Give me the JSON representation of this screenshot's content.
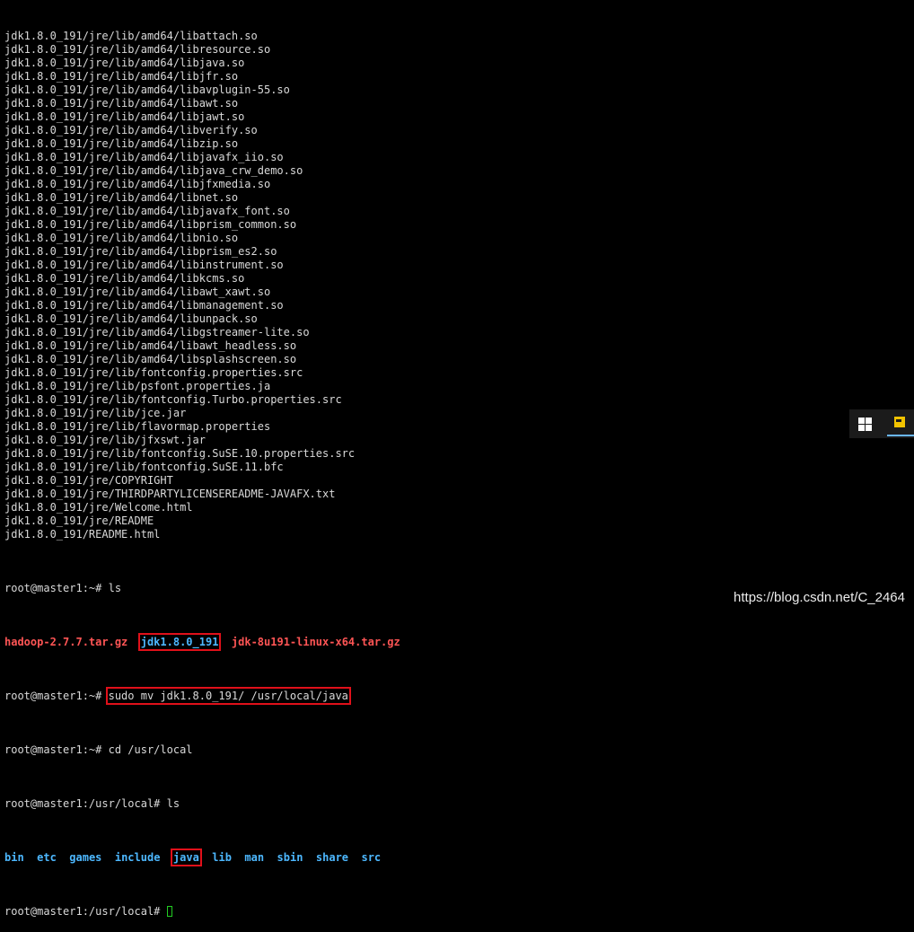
{
  "terminal": {
    "file_lines": [
      "jdk1.8.0_191/jre/lib/amd64/libattach.so",
      "jdk1.8.0_191/jre/lib/amd64/libresource.so",
      "jdk1.8.0_191/jre/lib/amd64/libjava.so",
      "jdk1.8.0_191/jre/lib/amd64/libjfr.so",
      "jdk1.8.0_191/jre/lib/amd64/libavplugin-55.so",
      "jdk1.8.0_191/jre/lib/amd64/libawt.so",
      "jdk1.8.0_191/jre/lib/amd64/libjawt.so",
      "jdk1.8.0_191/jre/lib/amd64/libverify.so",
      "jdk1.8.0_191/jre/lib/amd64/libzip.so",
      "jdk1.8.0_191/jre/lib/amd64/libjavafx_iio.so",
      "jdk1.8.0_191/jre/lib/amd64/libjava_crw_demo.so",
      "jdk1.8.0_191/jre/lib/amd64/libjfxmedia.so",
      "jdk1.8.0_191/jre/lib/amd64/libnet.so",
      "jdk1.8.0_191/jre/lib/amd64/libjavafx_font.so",
      "jdk1.8.0_191/jre/lib/amd64/libprism_common.so",
      "jdk1.8.0_191/jre/lib/amd64/libnio.so",
      "jdk1.8.0_191/jre/lib/amd64/libprism_es2.so",
      "jdk1.8.0_191/jre/lib/amd64/libinstrument.so",
      "jdk1.8.0_191/jre/lib/amd64/libkcms.so",
      "jdk1.8.0_191/jre/lib/amd64/libawt_xawt.so",
      "jdk1.8.0_191/jre/lib/amd64/libmanagement.so",
      "jdk1.8.0_191/jre/lib/amd64/libunpack.so",
      "jdk1.8.0_191/jre/lib/amd64/libgstreamer-lite.so",
      "jdk1.8.0_191/jre/lib/amd64/libawt_headless.so",
      "jdk1.8.0_191/jre/lib/amd64/libsplashscreen.so",
      "jdk1.8.0_191/jre/lib/fontconfig.properties.src",
      "jdk1.8.0_191/jre/lib/psfont.properties.ja",
      "jdk1.8.0_191/jre/lib/fontconfig.Turbo.properties.src",
      "jdk1.8.0_191/jre/lib/jce.jar",
      "jdk1.8.0_191/jre/lib/flavormap.properties",
      "jdk1.8.0_191/jre/lib/jfxswt.jar",
      "jdk1.8.0_191/jre/lib/fontconfig.SuSE.10.properties.src",
      "jdk1.8.0_191/jre/lib/fontconfig.SuSE.11.bfc",
      "jdk1.8.0_191/jre/COPYRIGHT",
      "jdk1.8.0_191/jre/THIRDPARTYLICENSEREADME-JAVAFX.txt",
      "jdk1.8.0_191/jre/Welcome.html",
      "jdk1.8.0_191/jre/README",
      "jdk1.8.0_191/README.html"
    ],
    "prompt_home": "root@master1:~# ",
    "cmd_ls1": "ls",
    "ls1": {
      "hadoop": "hadoop-2.7.7.tar.gz",
      "jdk_dir": "jdk1.8.0_191",
      "jdk_tar": "jdk-8u191-linux-x64.tar.gz"
    },
    "cmd_mv": "sudo mv jdk1.8.0_191/ /usr/local/java",
    "cmd_cd": "cd /usr/local",
    "prompt_local": "root@master1:/usr/local# ",
    "cmd_ls2": "ls",
    "ls2": {
      "bin": "bin",
      "etc": "etc",
      "games": "games",
      "include": "include",
      "java": "java",
      "lib": "lib",
      "man": "man",
      "sbin": "sbin",
      "share": "share",
      "src": "src"
    }
  },
  "colors": {
    "background": "#000000",
    "text": "#d9d9d9",
    "archive": "#ff5555",
    "directory": "#4db8ff",
    "highlight_box": "#e0101a",
    "cursor": "#22cc22"
  },
  "tray": {
    "icons": [
      "windows-icon",
      "sticky-note-icon"
    ]
  },
  "watermark": "https://blog.csdn.net/C_2464"
}
